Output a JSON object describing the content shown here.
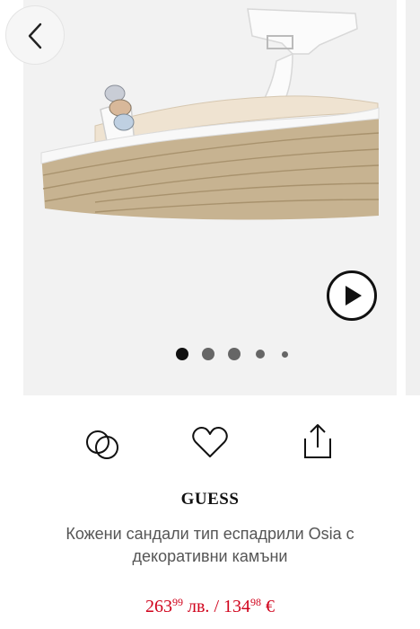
{
  "gallery": {
    "image_alt": "Кожени сандали тип еспадрили Osia с декоративни камъни",
    "slide_count": 5,
    "active_slide": 1
  },
  "icons": {
    "back": "chevron-left-icon",
    "play": "play-icon",
    "compare": "compare-circles-icon",
    "wishlist": "heart-icon",
    "share": "share-icon"
  },
  "product": {
    "brand": "GUESS",
    "title": "Кожени сандали тип еспадрили Osia с декоративни камъни",
    "price": {
      "bgn_int": "263",
      "bgn_dec": "99",
      "bgn_currency": "лв.",
      "separator": "/",
      "eur_int": "134",
      "eur_dec": "98",
      "eur_currency": "€"
    }
  },
  "colors": {
    "price": "#d0021b",
    "dot_active": "#111111",
    "dot_inactive": "#666666"
  }
}
